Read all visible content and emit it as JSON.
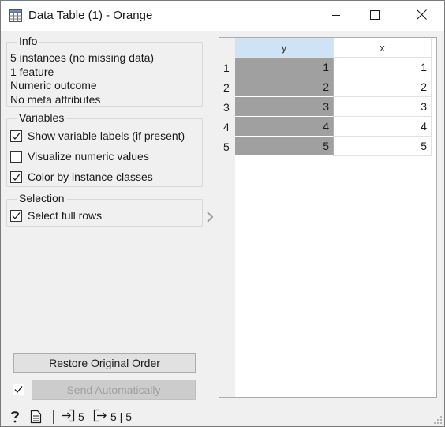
{
  "window": {
    "title": "Data Table (1) - Orange",
    "icon": "table-icon",
    "controls": [
      "minimize-icon",
      "maximize-icon",
      "close-icon"
    ]
  },
  "info": {
    "title": "Info",
    "lines": [
      "5 instances (no missing data)",
      "1 feature",
      "Numeric outcome",
      "No meta attributes"
    ]
  },
  "variables": {
    "title": "Variables",
    "options": [
      {
        "label": "Show variable labels (if present)",
        "checked": true
      },
      {
        "label": "Visualize numeric values",
        "checked": false
      },
      {
        "label": "Color by instance classes",
        "checked": true
      }
    ]
  },
  "selection": {
    "title": "Selection",
    "options": [
      {
        "label": "Select full rows",
        "checked": true
      }
    ]
  },
  "buttons": {
    "restore": "Restore Original Order",
    "send": "Send Automatically",
    "send_auto_checked": true
  },
  "table": {
    "columns": [
      "y",
      "x"
    ],
    "rows": [
      {
        "index": "1",
        "y": "1",
        "x": "1"
      },
      {
        "index": "2",
        "y": "2",
        "x": "2"
      },
      {
        "index": "3",
        "y": "3",
        "x": "3"
      },
      {
        "index": "4",
        "y": "4",
        "x": "4"
      },
      {
        "index": "5",
        "y": "5",
        "x": "5"
      }
    ],
    "colors": {
      "class_column": "#a0a0a0",
      "header_selected": "#cfe3f6"
    }
  },
  "status": {
    "input_count": "5",
    "output_count": "5 | 5"
  }
}
